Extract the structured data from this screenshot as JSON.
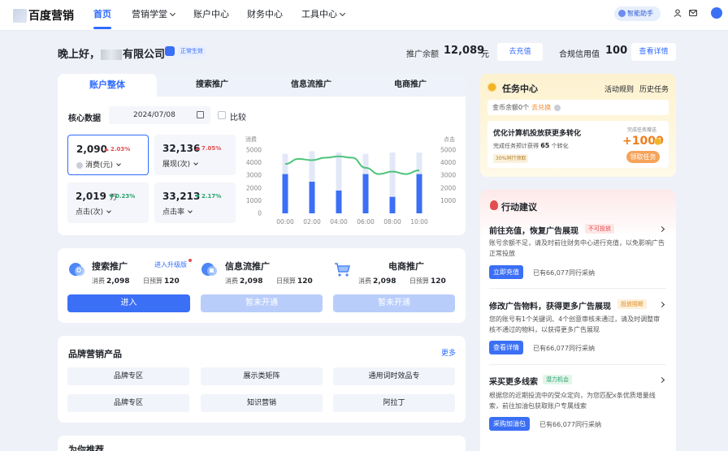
{
  "topnav": {
    "logo_text": "百度营销",
    "items": [
      {
        "label": "首页",
        "has_dropdown": false,
        "active": true
      },
      {
        "label": "营销学堂",
        "has_dropdown": true,
        "active": false
      },
      {
        "label": "账户中心",
        "has_dropdown": false,
        "active": false
      },
      {
        "label": "财务中心",
        "has_dropdown": false,
        "active": false
      },
      {
        "label": "工具中心",
        "has_dropdown": true,
        "active": false
      }
    ],
    "assistant_label": "智能助手",
    "icons": [
      "user-icon",
      "mail-icon",
      "avatar"
    ]
  },
  "header": {
    "greeting_prefix": "晚上好，",
    "company_suffix": "有限公司",
    "status_badge": "正常生效",
    "balance_label": "推广余额",
    "balance_value": "12,089",
    "balance_unit": "元",
    "recharge_button": "去充值",
    "credit_label": "合规信用值",
    "credit_value": "100",
    "details_button": "查看详情"
  },
  "overview": {
    "tabs": [
      {
        "label": "账户整体",
        "active": true
      },
      {
        "label": "搜索推广",
        "active": false
      },
      {
        "label": "信息流推广",
        "active": false
      },
      {
        "label": "电商推广",
        "active": false
      }
    ],
    "core_title": "核心数据",
    "date": "2024/07/08",
    "compare_label": "比较",
    "metrics": [
      {
        "value": "2,090",
        "unit": "",
        "trend": "up",
        "pct": "2.03%",
        "label": "消费(元)",
        "selected": true
      },
      {
        "value": "32,136",
        "unit": "",
        "trend": "up",
        "pct": "7.05%",
        "label": "展现(次)",
        "selected": false
      },
      {
        "value": "2,019",
        "unit": "万",
        "trend": "down",
        "pct": "0.23%",
        "label": "点击(次)",
        "selected": false
      },
      {
        "value": "33,213",
        "unit": "",
        "trend": "down",
        "pct": "2.17%",
        "label": "点击率",
        "selected": false
      }
    ]
  },
  "chart_data": {
    "type": "bar",
    "left_axis_label": "消费",
    "right_axis_label": "点击",
    "x": [
      "00:00",
      "01:00",
      "02:00",
      "03:00",
      "04:00",
      "05:00",
      "06:00",
      "07:00",
      "08:00",
      "09:00",
      "10:00"
    ],
    "x_tick_labels": [
      "00:00",
      "02:00",
      "04:00",
      "06:00",
      "08:00",
      "10:00"
    ],
    "left_ticks": [
      0,
      1000,
      2000,
      3000,
      4000,
      5000
    ],
    "right_ticks": [
      1000,
      2000,
      3000,
      4000,
      5000
    ],
    "ylim": [
      0,
      5000
    ],
    "bar_total": [
      4700,
      4900,
      4800,
      4700,
      4800,
      4800
    ],
    "bar_value": [
      3100,
      2500,
      1800,
      3100,
      1300,
      3100
    ],
    "bar_x_index": [
      0,
      2,
      4,
      6,
      8,
      10
    ],
    "line_values": [
      3900,
      4300,
      4200,
      4400,
      4500,
      4400,
      3600,
      3100,
      3300,
      3100,
      3400
    ],
    "colors": {
      "bar": "#3b6ff5",
      "bar_bg": "#e2e8f7",
      "line": "#4cc47a"
    }
  },
  "products": [
    {
      "title": "搜索推广",
      "extra_link": "进入升级版",
      "spend_label": "消费",
      "spend": "2,098",
      "budget_label": "日预算",
      "budget": "120",
      "button": "进入",
      "enabled": true,
      "icon": "search-promo-icon"
    },
    {
      "title": "信息流推广",
      "extra_link": "",
      "spend_label": "消费",
      "spend": "2,098",
      "budget_label": "日预算",
      "budget": "120",
      "button": "暂未开通",
      "enabled": false,
      "icon": "feed-promo-icon"
    },
    {
      "title": "电商推广",
      "extra_link": "",
      "spend_label": "消费",
      "spend": "2,098",
      "budget_label": "日预算",
      "budget": "120",
      "button": "暂未开通",
      "enabled": false,
      "icon": "ecommerce-cart-icon"
    }
  ],
  "brand": {
    "title": "品牌营销产品",
    "more": "更多",
    "items": [
      "品牌专区",
      "展示类矩阵",
      "通用词时效品专",
      "品牌专区",
      "知识营销",
      "阿拉丁"
    ]
  },
  "recommend_title": "为你推荐",
  "task_center": {
    "title": "任务中心",
    "links": [
      "活动规则",
      "历史任务"
    ],
    "gold_text": "金币余额0个",
    "gold_exchange": "去兑换",
    "task_title": "优化计算机投放获更多转化",
    "task_sub_pre": "完成任务预计获得",
    "task_sub_num": "65",
    "task_sub_post": "个转化",
    "task_chip": "30%同行领取",
    "done_label": "完成任务赠送",
    "reward": "+1000",
    "claim_button": "领取任务"
  },
  "advice": {
    "title": "行动建议",
    "items": [
      {
        "title": "前往充值，恢复广告展现",
        "tag": "不可投放",
        "tag_color": "#e34d4d",
        "tag_bg": "#fde6e6",
        "desc": "账号余额不足，请及时前往财务中心进行充值，以免影响广告正常投放",
        "button": "立即充值",
        "peer": "已有66,077同行采纳"
      },
      {
        "title": "修改广告物料，获得更多广告展现",
        "tag": "投放阻断",
        "tag_color": "#e08a1e",
        "tag_bg": "#fdf0dc",
        "desc": "您的账号有1个关键词、4个创意审核未通过，请及时调整审核不通过的物料，以获得更多广告展现",
        "button": "查看详情",
        "peer": "已有66,077同行采纳"
      },
      {
        "title": "采买更多线索",
        "tag": "潜力机会",
        "tag_color": "#27a36a",
        "tag_bg": "#e3f5ea",
        "desc": "根据您的近期投流中的受众定向，为您匹配x条优质增量线索，前往加油包获取账户专属线索",
        "button": "采购加油包",
        "peer": "已有66,077同行采纳"
      }
    ]
  }
}
